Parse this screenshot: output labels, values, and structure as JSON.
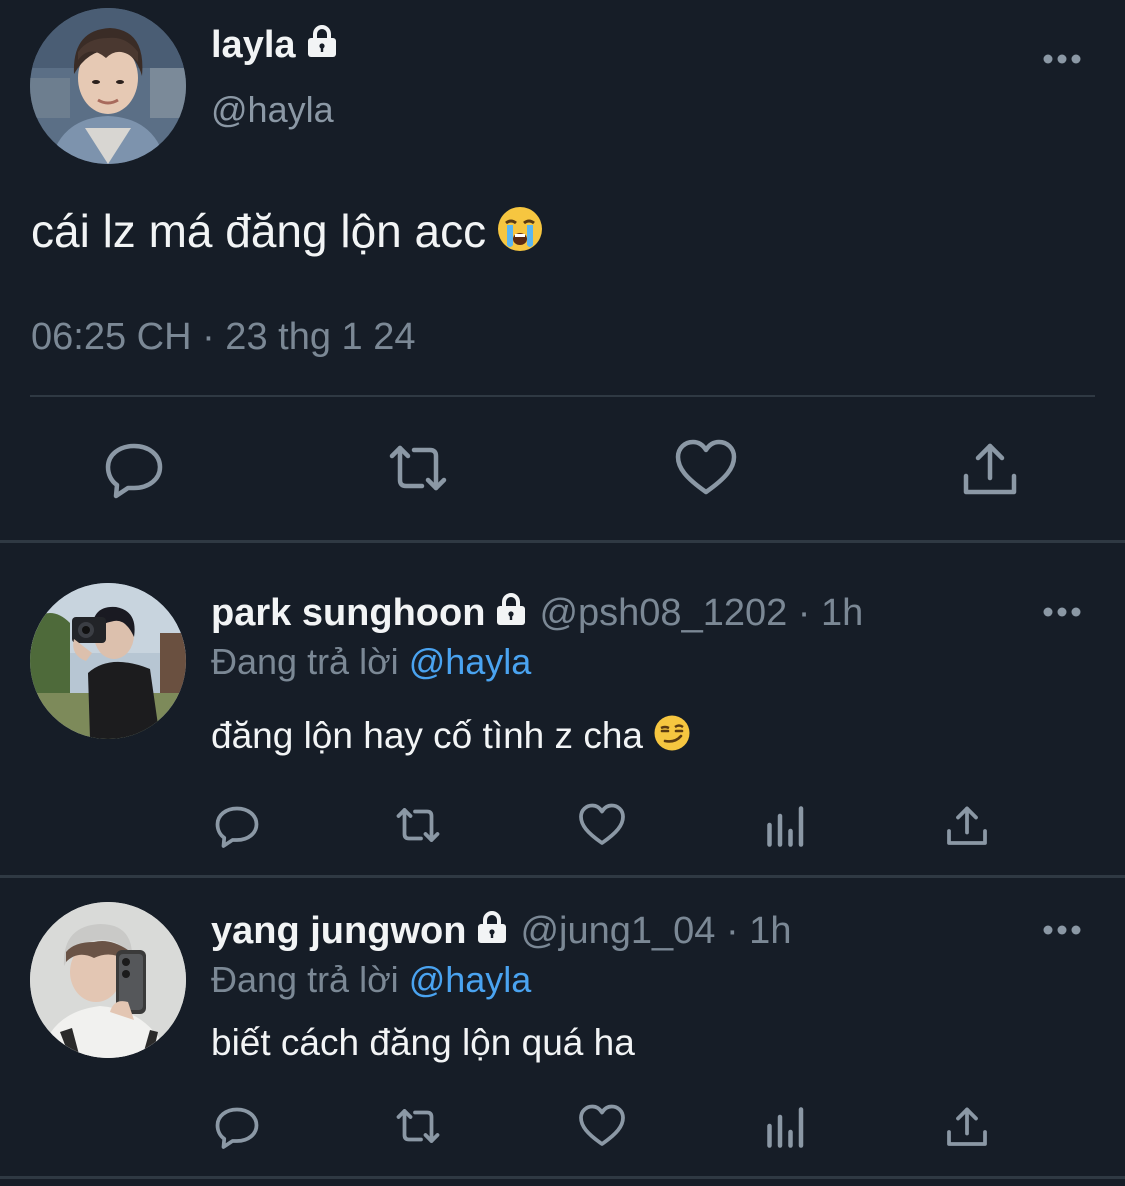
{
  "main_tweet": {
    "display_name": "layla",
    "handle": "@hayla",
    "text": "cái lz má đăng lộn acc",
    "emoji": "loudly-crying-face",
    "timestamp": "06:25 CH · 23 thg 1 24",
    "actions": [
      "reply-icon",
      "retweet-icon",
      "like-icon",
      "share-icon"
    ]
  },
  "replies": [
    {
      "display_name": "park sunghoon",
      "handle": "@psh08_1202",
      "time": "· 1h",
      "replying_prefix": "Đang trả lời",
      "replying_to": "@hayla",
      "text": "đăng lộn hay cố tình z cha",
      "emoji": "smirking-face",
      "actions": [
        "reply-icon",
        "retweet-icon",
        "like-icon",
        "views-icon",
        "share-icon"
      ]
    },
    {
      "display_name": "yang jungwon",
      "handle": "@jung1_04",
      "time": "· 1h",
      "replying_prefix": "Đang trả lời",
      "replying_to": "@hayla",
      "text": "biết cách đăng lộn quá ha",
      "actions": [
        "reply-icon",
        "retweet-icon",
        "like-icon",
        "views-icon",
        "share-icon"
      ]
    }
  ],
  "colors": {
    "background": "#161d27",
    "text_primary": "#f2f4f5",
    "text_secondary": "#7b8895",
    "link": "#4aa3f0",
    "divider": "#2f3943",
    "icon": "#8b98a5"
  }
}
